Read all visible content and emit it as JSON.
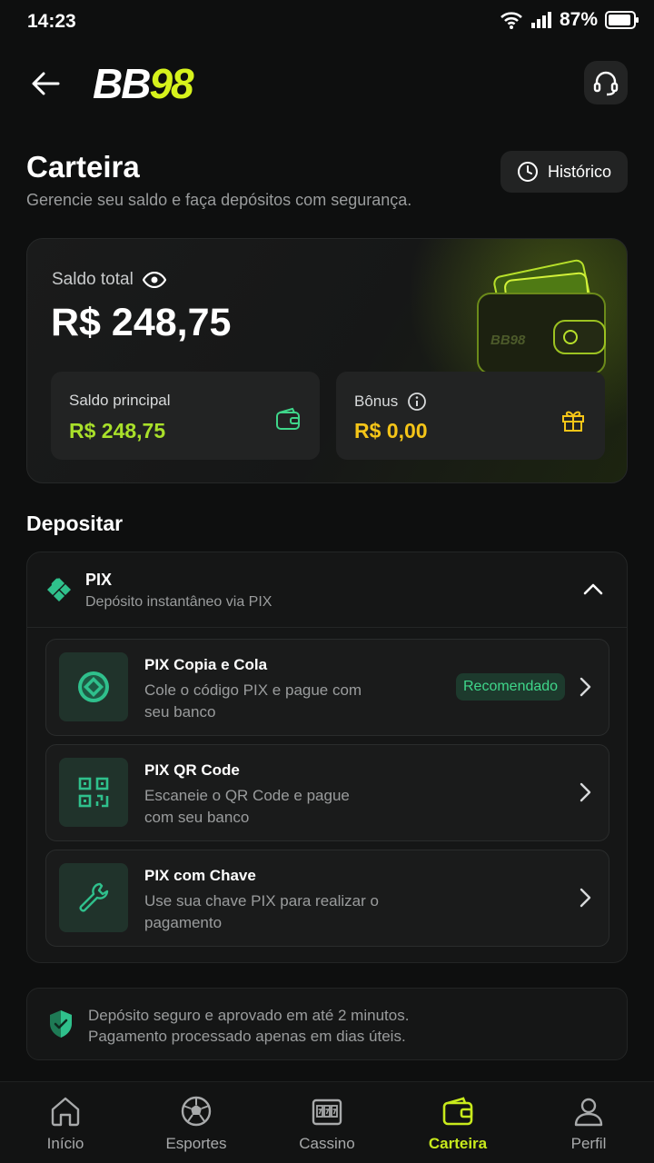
{
  "status": {
    "time": "14:23",
    "battery": "87%"
  },
  "header": {
    "logo_bb": "BB",
    "logo_num": "98"
  },
  "page": {
    "title": "Carteira",
    "subtitle": "Gerencie seu saldo e faça depósitos com segurança.",
    "history_label": "Histórico"
  },
  "balance": {
    "total_label": "Saldo total",
    "total_value": "R$ 248,75",
    "main_label": "Saldo principal",
    "main_value": "R$ 248,75",
    "bonus_label": "Bônus",
    "bonus_value": "R$ 0,00",
    "wallet_brand": "BB98"
  },
  "deposit": {
    "title": "Depositar",
    "method_name": "PIX",
    "method_desc": "Depósito instantâneo via PIX",
    "options": [
      {
        "title": "PIX Copia e Cola",
        "desc": "Cole o código PIX e pague com seu banco",
        "badge": "Recomendado",
        "icon": "pix-coin-icon"
      },
      {
        "title": "PIX QR Code",
        "desc": "Escaneie o QR Code e pague com seu banco",
        "icon": "qr-code-icon"
      },
      {
        "title": "PIX com Chave",
        "desc": "Use sua chave PIX para realizar o pagamento",
        "icon": "wrench-icon"
      }
    ]
  },
  "note": {
    "line1": "Depósito seguro e aprovado em até 2 minutos.",
    "line2": "Pagamento processado apenas em dias úteis."
  },
  "nav": [
    {
      "label": "Início",
      "icon": "home-icon"
    },
    {
      "label": "Esportes",
      "icon": "soccer-ball-icon"
    },
    {
      "label": "Cassino",
      "icon": "slot-machine-icon"
    },
    {
      "label": "Carteira",
      "icon": "wallet-icon",
      "active": true
    },
    {
      "label": "Perfil",
      "icon": "user-icon"
    }
  ],
  "colors": {
    "accent": "#c8ea1c",
    "green": "#3fd68a",
    "yellow": "#f5c518",
    "bg": "#0e0f0f"
  }
}
